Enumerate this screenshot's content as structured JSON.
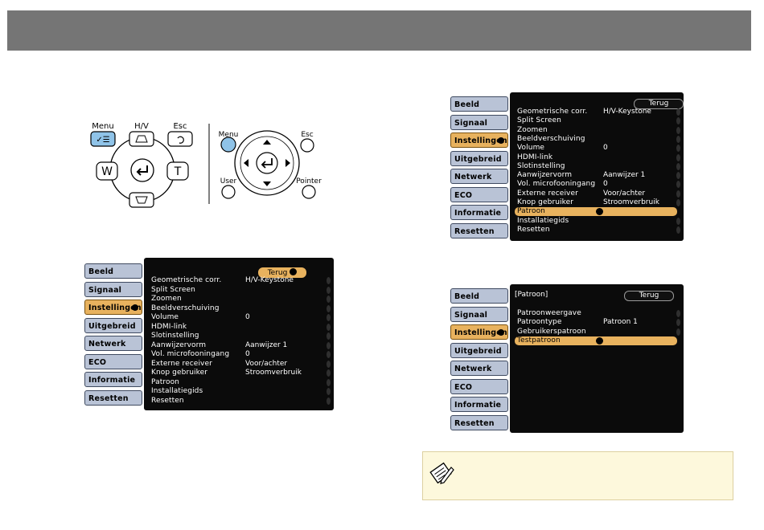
{
  "remote_control": {
    "labels": {
      "menu": "Menu",
      "hv": "H/V",
      "esc": "Esc",
      "w": "W",
      "t": "T"
    }
  },
  "projector_panel": {
    "labels": {
      "menu": "Menu",
      "esc": "Esc",
      "user": "User",
      "pointer": "Pointer"
    }
  },
  "sidebar_tabs": [
    "Beeld",
    "Signaal",
    "Instellingen",
    "Uitgebreid",
    "Netwerk",
    "ECO",
    "Informatie",
    "Resetten"
  ],
  "menu_back": "Terug",
  "settings_menu": [
    {
      "label": "Geometrische corr.",
      "value": "H/V-Keystone"
    },
    {
      "label": "Split Screen",
      "value": ""
    },
    {
      "label": "Zoomen",
      "value": ""
    },
    {
      "label": "Beeldverschuiving",
      "value": ""
    },
    {
      "label": "Volume",
      "value": "0"
    },
    {
      "label": "HDMI-link",
      "value": ""
    },
    {
      "label": "Slotinstelling",
      "value": ""
    },
    {
      "label": "Aanwijzervorm",
      "value": "Aanwijzer 1"
    },
    {
      "label": "Vol. microfooningang",
      "value": "0"
    },
    {
      "label": "Externe receiver",
      "value": "Voor/achter"
    },
    {
      "label": "Knop gebruiker",
      "value": "Stroomverbruik"
    },
    {
      "label": "Patroon",
      "value": ""
    },
    {
      "label": "Installatiegids",
      "value": ""
    },
    {
      "label": "Resetten",
      "value": ""
    }
  ],
  "pattern_menu": {
    "title": "[Patroon]",
    "items": [
      {
        "label": "Patroonweergave",
        "value": ""
      },
      {
        "label": "Patroontype",
        "value": "Patroon 1"
      },
      {
        "label": "Gebruikerspatroon",
        "value": ""
      },
      {
        "label": "Testpatroon",
        "value": ""
      }
    ]
  },
  "note_icon": "pencil-note-icon",
  "colors": {
    "header": "#757575",
    "highlight": "#e8b25e",
    "tab": "#b9c3d6",
    "menu_bg": "#0b0b0b",
    "note_bg": "#fdf8dc",
    "menu_key": "#8fc3e8"
  }
}
